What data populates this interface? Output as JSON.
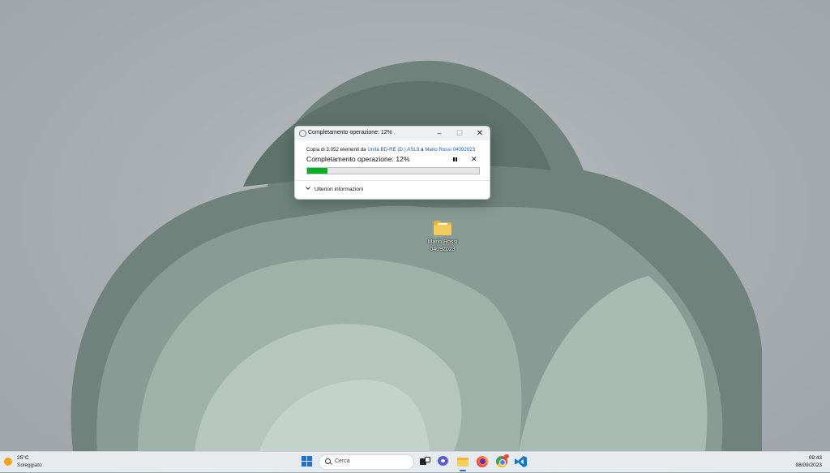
{
  "desktop": {
    "icon": {
      "name": "Mario Rossi 04092023",
      "line1": "Mario Rossi",
      "line2": "04092023"
    }
  },
  "dialog": {
    "title": "Completamento operazione: 12%",
    "copy_prefix": "Copia di 3.052 elementi da ",
    "source": "Unità BD-RE (D:) ASL9",
    "mid": " a ",
    "destination": "Mario Rossi 04092023",
    "status": "Completamento operazione: 12%",
    "progress_fraction": 0.12,
    "more_info": "Ulteriori informazioni",
    "buttons": {
      "minimize": "–",
      "maximize": "☐",
      "close": "✕",
      "stop": "✕"
    }
  },
  "taskbar": {
    "weather": {
      "temp": "25°C",
      "condition": "Soleggiato"
    },
    "search_placeholder": "Cerca",
    "apps": [
      "start-icon",
      "search",
      "task-view-icon",
      "chat-icon",
      "file-explorer-icon",
      "firefox-icon",
      "chrome-icon",
      "vscode-icon"
    ],
    "time": "09:43",
    "date": "08/09/2023"
  },
  "colors": {
    "progress": "#06b025",
    "link": "#1a5fb4",
    "accent": "#1e6fd9"
  }
}
